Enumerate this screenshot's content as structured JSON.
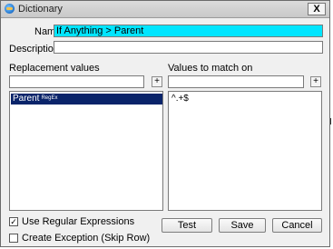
{
  "window": {
    "title": "Dictionary",
    "close_glyph": "X",
    "app_icon": "dictionary-app-icon"
  },
  "fields": {
    "name_label": "Name:",
    "name_value": "If Anything > Parent",
    "description_label": "Description:",
    "description_value": ""
  },
  "replacement": {
    "header": "Replacement values",
    "input_value": "",
    "add_label": "+",
    "items": [
      {
        "text": "Parent",
        "tag": "RegEx",
        "selected": true
      }
    ]
  },
  "match": {
    "header": "Values to match on",
    "input_value": "",
    "add_label": "+",
    "items": [
      {
        "text": "^.+$"
      }
    ]
  },
  "options": {
    "use_regex_label": "Use Regular Expressions",
    "use_regex_checked": true,
    "create_exception_label": "Create Exception (Skip Row)",
    "create_exception_checked": false,
    "check_glyph": "✓"
  },
  "buttons": {
    "test": "Test",
    "save": "Save",
    "cancel": "Cancel"
  },
  "colors": {
    "highlight_field": "#00e5ff",
    "selection": "#0a246a"
  }
}
